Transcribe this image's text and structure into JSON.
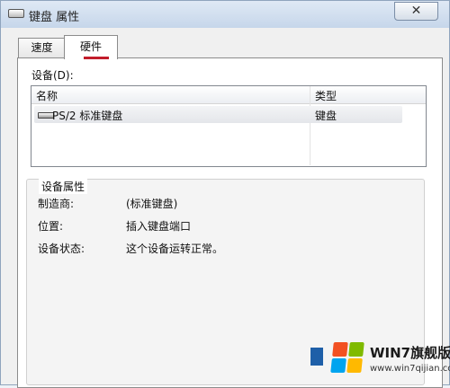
{
  "window": {
    "title": "键盘 属性",
    "close_glyph": "✕"
  },
  "tabs": [
    {
      "label": "速度",
      "selected": false
    },
    {
      "label": "硬件",
      "selected": true
    }
  ],
  "devices": {
    "label": "设备(D):",
    "columns": {
      "name": "名称",
      "type": "类型"
    },
    "rows": [
      {
        "icon": "keyboard-icon",
        "name": "PS/2 标准键盘",
        "type": "键盘",
        "selected": true
      }
    ]
  },
  "properties": {
    "title": "设备属性",
    "manufacturer": {
      "label": "制造商:",
      "value": "(标准键盘)"
    },
    "location": {
      "label": "位置:",
      "value": "插入键盘端口"
    },
    "status": {
      "label": "设备状态:",
      "value": "这个设备运转正常。"
    }
  },
  "watermark": {
    "text": "WIN7旗舰版",
    "url": "www.win7qijian.com"
  },
  "colors": {
    "tab_accent": "#c21d2b",
    "window_border": "#8fa4bd"
  }
}
